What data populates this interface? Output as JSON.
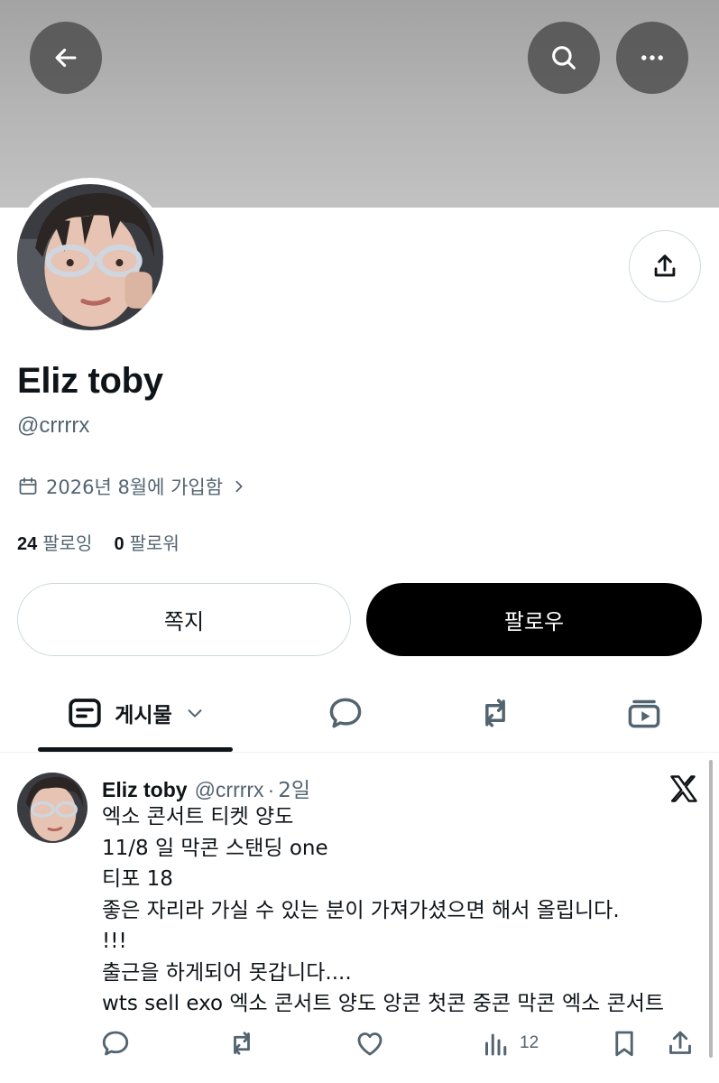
{
  "header": {
    "back_icon": "arrow-left-icon",
    "search_icon": "search-icon",
    "more_icon": "more-horizontal-icon"
  },
  "profile": {
    "display_name": "Eliz toby",
    "handle": "@crrrrx",
    "joined": "2026년 8월에 가입함",
    "following_count": "24",
    "following_label": "팔로잉",
    "followers_count": "0",
    "followers_label": "팔로워",
    "share_icon": "share-icon"
  },
  "buttons": {
    "message_label": "쪽지",
    "follow_label": "팔로우"
  },
  "tabs": {
    "posts_label": "게시물",
    "replies_icon": "speech-bubble-icon",
    "reposts_icon": "repost-icon",
    "media_icon": "video-stack-icon"
  },
  "post": {
    "author_name": "Eliz toby",
    "author_handle": "@crrrrx",
    "separator": "·",
    "time": "2일",
    "lines": [
      "엑소 콘서트 티켓 양도",
      "11/8 일 막콘 스탠딩 one",
      "티포 18",
      "좋은 자리라 가실 수 있는 분이 가져가셨으면 해서 올립니다.",
      "!!!",
      "출근을 하게되어 못갑니다....",
      "wts sell exo 엑소 콘서트 양도 앙콘 첫콘 중콘 막콘 엑소 콘서트"
    ],
    "views_count": "12"
  },
  "colors": {
    "text_primary": "#0f1419",
    "text_secondary": "#536471",
    "border": "#cfd9de",
    "follow_bg": "#000000"
  }
}
